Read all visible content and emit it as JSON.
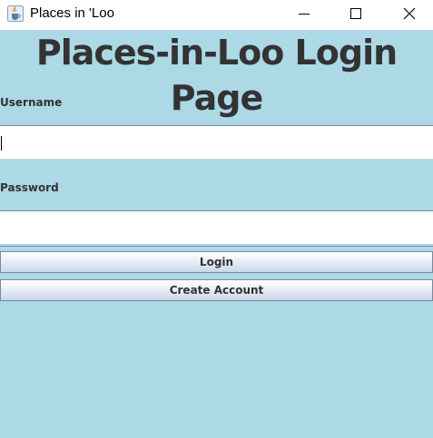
{
  "window": {
    "title": "Places in 'Loo",
    "app_icon": "java-cup-icon",
    "controls": [
      "minimize-icon",
      "maximize-icon",
      "close-icon"
    ]
  },
  "page": {
    "heading": "Places-in-Loo Login Page",
    "background": "#add8e6"
  },
  "form": {
    "username_label": "Username",
    "username_value": "",
    "password_label": "Password",
    "password_value": ""
  },
  "buttons": {
    "login": "Login",
    "create_account": "Create Account"
  }
}
